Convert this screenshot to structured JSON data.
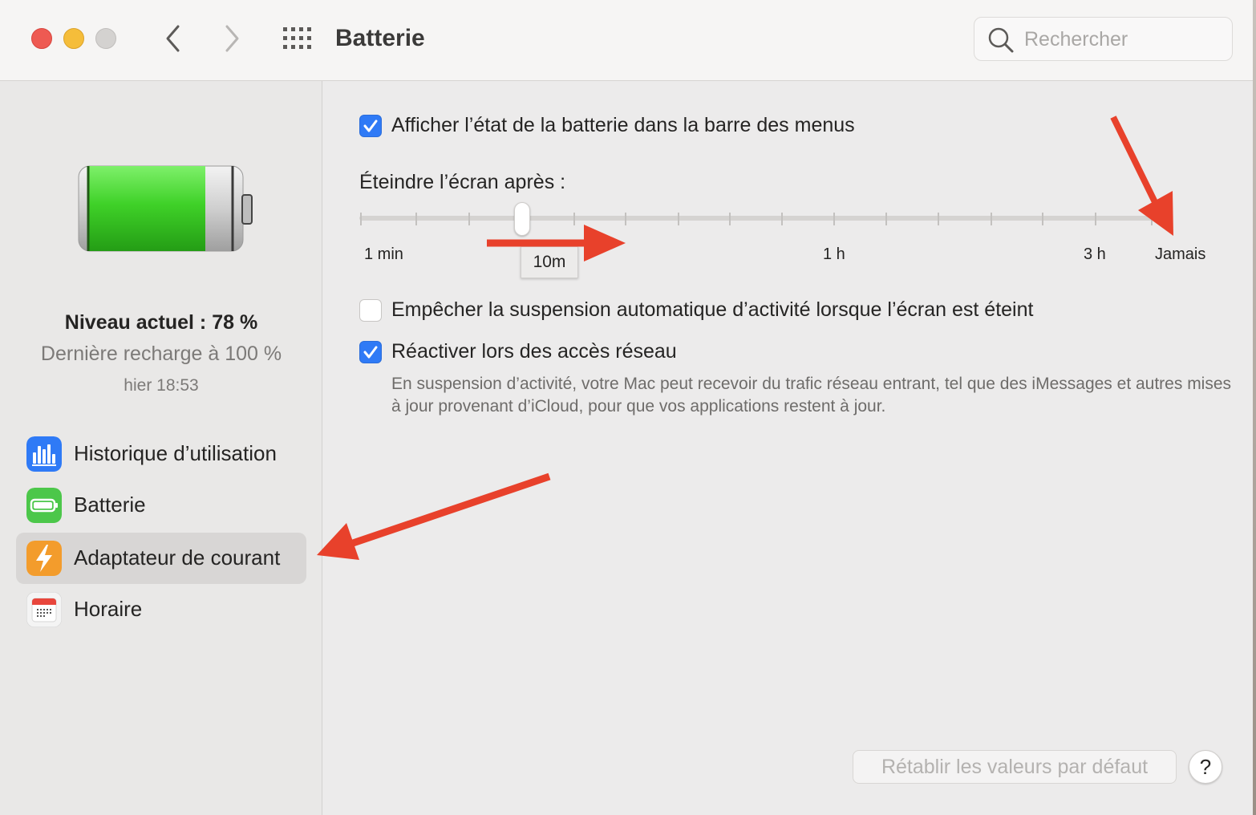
{
  "window": {
    "title": "Batterie",
    "search_placeholder": "Rechercher"
  },
  "sidebar": {
    "level_text": "Niveau actuel : 78 %",
    "battery_level_percent": 78,
    "last_charge_text": "Dernière recharge à 100 %",
    "last_charge_time": "hier 18:53",
    "items": [
      {
        "label": "Historique d’utilisation",
        "icon": "bar-chart-icon",
        "selected": false
      },
      {
        "label": "Batterie",
        "icon": "battery-icon",
        "selected": false
      },
      {
        "label": "Adaptateur de courant",
        "icon": "lightning-icon",
        "selected": true
      },
      {
        "label": "Horaire",
        "icon": "calendar-icon",
        "selected": false
      }
    ]
  },
  "main": {
    "show_status_label": "Afficher l’état de la batterie dans la barre des menus",
    "show_status_checked": true,
    "display_off_label": "Éteindre l’écran après :",
    "slider_ticks": [
      "1 min",
      "1 h",
      "3 h",
      "Jamais"
    ],
    "slider_tooltip": "10m",
    "prevent_sleep_label": "Empêcher la suspension automatique d’activité lorsque l’écran est éteint",
    "prevent_sleep_checked": false,
    "wake_network_label": "Réactiver lors des accès réseau",
    "wake_network_checked": true,
    "wake_network_desc": "En suspension d’activité, votre Mac peut recevoir du trafic réseau entrant, tel que des iMessages et autres mises à jour provenant d’iCloud, pour que vos applications restent à jour.",
    "reset_label": "Rétablir les valeurs par défaut",
    "help_label": "?"
  },
  "colors": {
    "accent": "#2f7af6",
    "annotation_arrow": "#e8412b",
    "battery_green": "#3fd128"
  }
}
